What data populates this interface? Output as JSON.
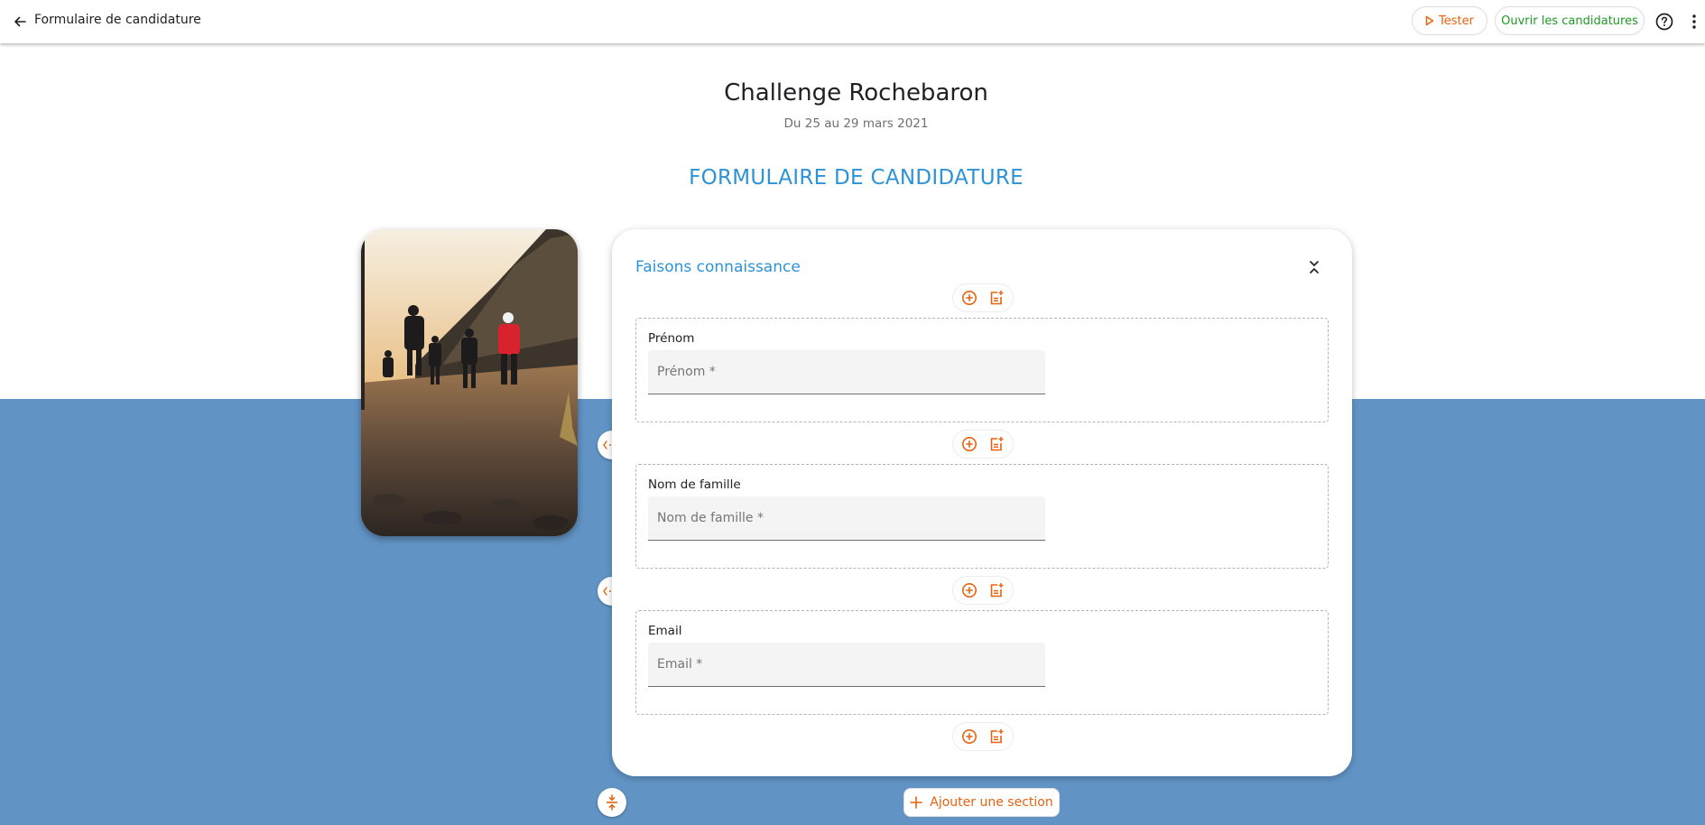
{
  "topbar": {
    "title": "Formulaire de candidature",
    "tester_label": "Tester",
    "open_label": "Ouvrir les candidatures"
  },
  "event": {
    "title": "Challenge Rochebaron",
    "date": "Du 25 au 29 mars 2021"
  },
  "form_heading": "FORMULAIRE DE CANDIDATURE",
  "section": {
    "title": "Faisons connaissance",
    "fields": [
      {
        "label": "Prénom",
        "placeholder": "Prénom *"
      },
      {
        "label": "Nom de famille",
        "placeholder": "Nom de famille *"
      },
      {
        "label": "Email",
        "placeholder": "Email *"
      }
    ]
  },
  "add_section_label": "Ajouter une section",
  "icons": {
    "back": "arrow-left-icon",
    "tester": "play-icon",
    "help": "help-circle-icon",
    "more": "more-vertical-icon",
    "collapse": "collapse-icon",
    "add_field": "add-circle-icon",
    "add_block": "note-add-icon",
    "resize": "resize-horizontal-icon",
    "vertical_align": "vertical-align-center-icon",
    "add_section": "plus-icon"
  },
  "colors": {
    "accent_orange": "#e8620f",
    "accent_blue": "#2d93d7",
    "green": "#1f9a24",
    "background_blue": "#6194c5"
  }
}
